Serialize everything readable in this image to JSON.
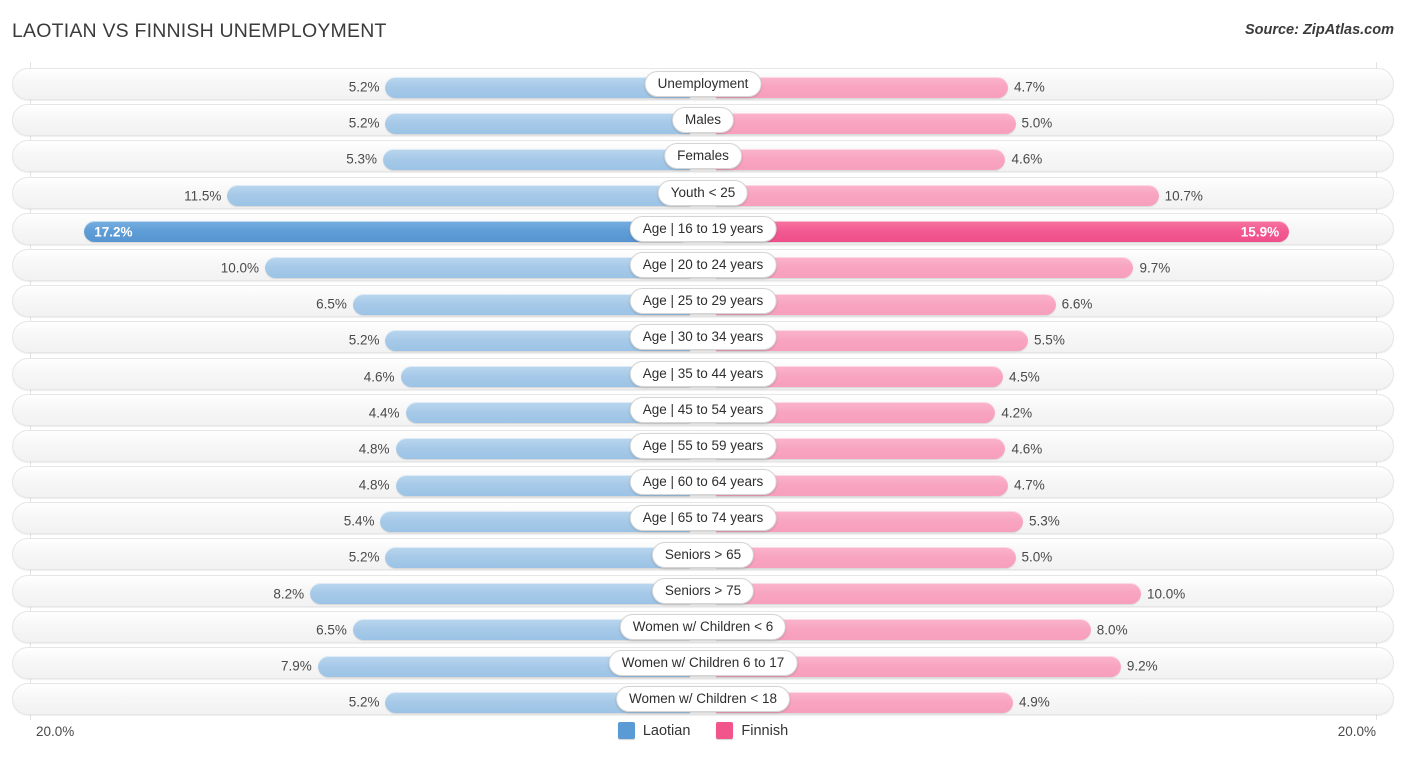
{
  "header": {
    "title": "LAOTIAN VS FINNISH UNEMPLOYMENT",
    "source": "Source: ZipAtlas.com"
  },
  "axis": {
    "left_label": "20.0%",
    "right_label": "20.0%",
    "max": 20.0
  },
  "legend": {
    "items": [
      {
        "label": "Laotian",
        "color": "#5b9bd5"
      },
      {
        "label": "Finnish",
        "color": "#f2548c"
      }
    ]
  },
  "colors": {
    "laotian_bar": "#a6c9e8",
    "finnish_bar": "#f8a4c0",
    "laotian_bar_highlight": "#5f9dd6",
    "finnish_bar_highlight": "#f25991",
    "track": "#f5f5f5",
    "gridline": "#e3e3e3"
  },
  "chart_data": {
    "type": "bar",
    "title": "LAOTIAN VS FINNISH UNEMPLOYMENT",
    "subtitle": "Source: ZipAtlas.com",
    "orientation": "horizontal-diverging",
    "xlabel": "",
    "ylabel": "",
    "xlim": [
      -20.0,
      20.0
    ],
    "grid": true,
    "legend_position": "bottom-center",
    "categories": [
      "Unemployment",
      "Males",
      "Females",
      "Youth < 25",
      "Age | 16 to 19 years",
      "Age | 20 to 24 years",
      "Age | 25 to 29 years",
      "Age | 30 to 34 years",
      "Age | 35 to 44 years",
      "Age | 45 to 54 years",
      "Age | 55 to 59 years",
      "Age | 60 to 64 years",
      "Age | 65 to 74 years",
      "Seniors > 65",
      "Seniors > 75",
      "Women w/ Children < 6",
      "Women w/ Children 6 to 17",
      "Women w/ Children < 18"
    ],
    "series": [
      {
        "name": "Laotian",
        "color": "#a6c9e8",
        "values": [
          5.2,
          5.2,
          5.3,
          11.5,
          17.2,
          10.0,
          6.5,
          5.2,
          4.6,
          4.4,
          4.8,
          4.8,
          5.4,
          5.2,
          8.2,
          6.5,
          7.9,
          5.2
        ]
      },
      {
        "name": "Finnish",
        "color": "#f8a4c0",
        "values": [
          4.7,
          5.0,
          4.6,
          10.7,
          15.9,
          9.7,
          6.6,
          5.5,
          4.5,
          4.2,
          4.6,
          4.7,
          5.3,
          5.0,
          10.0,
          8.0,
          9.2,
          4.9
        ]
      }
    ],
    "highlighted_category": "Age | 16 to 19 years"
  },
  "rows": [
    {
      "label": "Unemployment",
      "left_value": "5.2%",
      "right_value": "4.7%",
      "left": 5.2,
      "right": 4.7,
      "highlight": false
    },
    {
      "label": "Males",
      "left_value": "5.2%",
      "right_value": "5.0%",
      "left": 5.2,
      "right": 5.0,
      "highlight": false
    },
    {
      "label": "Females",
      "left_value": "5.3%",
      "right_value": "4.6%",
      "left": 5.3,
      "right": 4.6,
      "highlight": false
    },
    {
      "label": "Youth < 25",
      "left_value": "11.5%",
      "right_value": "10.7%",
      "left": 11.5,
      "right": 10.7,
      "highlight": false
    },
    {
      "label": "Age | 16 to 19 years",
      "left_value": "17.2%",
      "right_value": "15.9%",
      "left": 17.2,
      "right": 15.9,
      "highlight": true
    },
    {
      "label": "Age | 20 to 24 years",
      "left_value": "10.0%",
      "right_value": "9.7%",
      "left": 10.0,
      "right": 9.7,
      "highlight": false
    },
    {
      "label": "Age | 25 to 29 years",
      "left_value": "6.5%",
      "right_value": "6.6%",
      "left": 6.5,
      "right": 6.6,
      "highlight": false
    },
    {
      "label": "Age | 30 to 34 years",
      "left_value": "5.2%",
      "right_value": "5.5%",
      "left": 5.2,
      "right": 5.5,
      "highlight": false
    },
    {
      "label": "Age | 35 to 44 years",
      "left_value": "4.6%",
      "right_value": "4.5%",
      "left": 4.6,
      "right": 4.5,
      "highlight": false
    },
    {
      "label": "Age | 45 to 54 years",
      "left_value": "4.4%",
      "right_value": "4.2%",
      "left": 4.4,
      "right": 4.2,
      "highlight": false
    },
    {
      "label": "Age | 55 to 59 years",
      "left_value": "4.8%",
      "right_value": "4.6%",
      "left": 4.8,
      "right": 4.6,
      "highlight": false
    },
    {
      "label": "Age | 60 to 64 years",
      "left_value": "4.8%",
      "right_value": "4.7%",
      "left": 4.8,
      "right": 4.7,
      "highlight": false
    },
    {
      "label": "Age | 65 to 74 years",
      "left_value": "5.4%",
      "right_value": "5.3%",
      "left": 5.4,
      "right": 5.3,
      "highlight": false
    },
    {
      "label": "Seniors > 65",
      "left_value": "5.2%",
      "right_value": "5.0%",
      "left": 5.2,
      "right": 5.0,
      "highlight": false
    },
    {
      "label": "Seniors > 75",
      "left_value": "8.2%",
      "right_value": "10.0%",
      "left": 8.2,
      "right": 10.0,
      "highlight": false
    },
    {
      "label": "Women w/ Children < 6",
      "left_value": "6.5%",
      "right_value": "8.0%",
      "left": 6.5,
      "right": 8.0,
      "highlight": false
    },
    {
      "label": "Women w/ Children 6 to 17",
      "left_value": "7.9%",
      "right_value": "9.2%",
      "left": 7.9,
      "right": 9.2,
      "highlight": false
    },
    {
      "label": "Women w/ Children < 18",
      "left_value": "5.2%",
      "right_value": "4.9%",
      "left": 5.2,
      "right": 4.9,
      "highlight": false
    }
  ]
}
